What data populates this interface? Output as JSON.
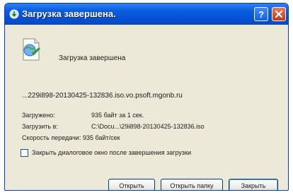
{
  "window": {
    "title": "Загрузка завершена."
  },
  "dialog": {
    "headline": "Загрузка завершена",
    "url": "...229i898-20130425-132836.iso.vo.psoft.mgonb.ru",
    "info": [
      {
        "label": "Загружено:",
        "value": "935 байт за 1 сек."
      },
      {
        "label": "Загрузить в:",
        "value": "C:\\Docu...\\29i898-20130425-132836.iso"
      },
      {
        "label": "Скорость передачи:",
        "value": "935 байт/сек"
      }
    ],
    "close_on_finish_label": "Закрыть диалоговое окно после завершения загрузки",
    "close_on_finish_checked": false
  },
  "buttons": {
    "open": "Открыть",
    "open_folder": "Открыть папку",
    "close": "Закрыть"
  },
  "icons": {
    "title": "globe-download-icon",
    "main": "download-complete-icon",
    "help": "help-icon",
    "close": "close-icon"
  },
  "colors": {
    "titlebar": "#0b5de0",
    "dialog_bg": "#ece9d8",
    "close_button": "#c4361b"
  }
}
